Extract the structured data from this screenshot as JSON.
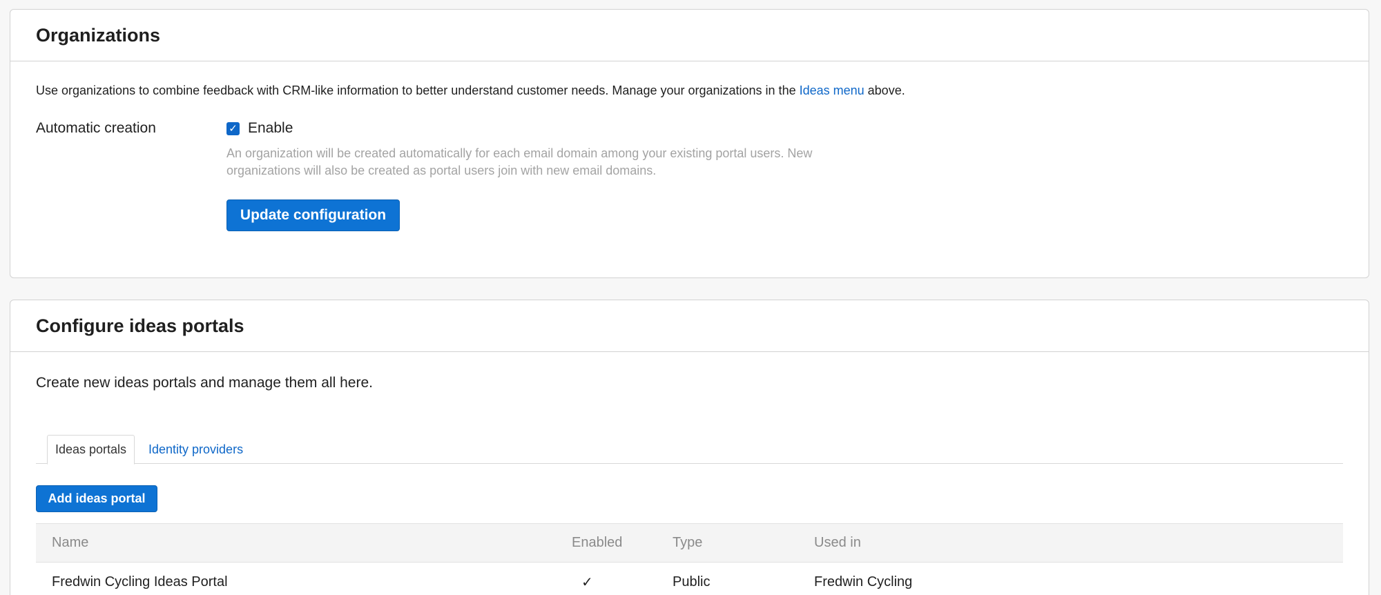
{
  "organizations": {
    "title": "Organizations",
    "description_prefix": "Use organizations to combine feedback with CRM-like information to better understand customer needs. Manage your organizations in the ",
    "description_link": "Ideas menu",
    "description_suffix": " above.",
    "automatic_creation_label": "Automatic creation",
    "enable_label": "Enable",
    "enable_checked": true,
    "help_text": "An organization will be created automatically for each email domain among your existing portal users. New organizations will also be created as portal users join with new email domains.",
    "update_button": "Update configuration"
  },
  "portals": {
    "title": "Configure ideas portals",
    "description": "Create new ideas portals and manage them all here.",
    "tabs": [
      {
        "label": "Ideas portals",
        "active": true
      },
      {
        "label": "Identity providers",
        "active": false
      }
    ],
    "add_button": "Add ideas portal",
    "table": {
      "columns": [
        "Name",
        "Enabled",
        "Type",
        "Used in"
      ],
      "rows": [
        {
          "name": "Fredwin Cycling Ideas Portal",
          "enabled": "✓",
          "type": "Public",
          "used_in": "Fredwin Cycling"
        }
      ]
    }
  },
  "colors": {
    "accent": "#0e73d4",
    "link": "#0e67c8",
    "help_text": "#a3a3a3",
    "header_text": "#8a8a8a"
  }
}
